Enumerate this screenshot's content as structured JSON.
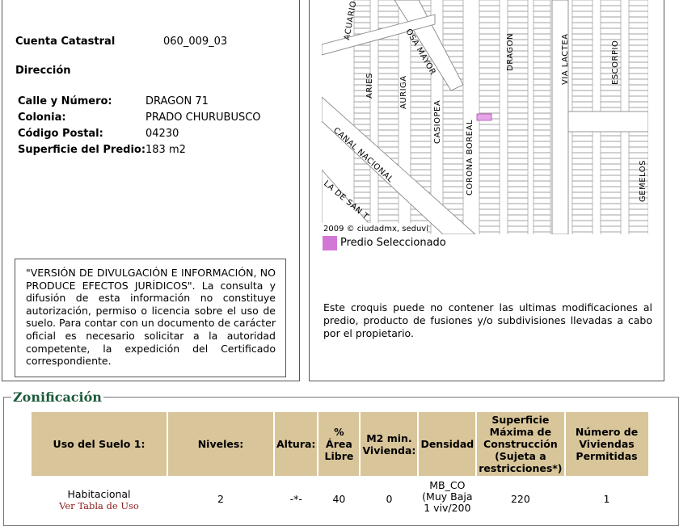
{
  "info": {
    "cuenta_label": "Cuenta Catastral",
    "cuenta_value": "060_009_03",
    "direccion_label": "Dirección",
    "calle_label": "Calle y Número:",
    "calle_value": "DRAGON 71",
    "colonia_label": "Colonia:",
    "colonia_value": "PRADO CHURUBUSCO",
    "cp_label": "Código Postal:",
    "cp_value": "04230",
    "superficie_label": "Superficie del Predio:",
    "superficie_value": "183 m2"
  },
  "disclaimer": "\"VERSIÓN DE DIVULGACIÓN E INFORMACIÓN, NO PRODUCE EFECTOS JURÍDICOS\". La consulta y difusión de esta información no constituye autorización, permiso o licencia sobre el uso de suelo. Para contar con un documento de carácter oficial es necesario solicitar a la autoridad competente, la expedición del Certificado correspondiente.",
  "map": {
    "credit": "2009 © ciudadmx, seduvi",
    "streets": [
      "ACUARIO",
      "OSA MAYOR",
      "ARIES",
      "AURIGA",
      "CASIOPEA",
      "DRAGON",
      "VIA LACTEA",
      "ESCORPIO",
      "CANAL NACIONAL",
      "CORONA BOREAL",
      "GEMELOS",
      "LA DE SAN T"
    ],
    "legend_label": "Predio Seleccionado",
    "highlight_color": "#d277d6",
    "note": "Este croquis puede no contener las ultimas modificaciones al predio, producto de fusiones y/o subdivisiones llevadas a cabo por el propietario."
  },
  "zonificacion": {
    "title": "Zonificación",
    "headers": [
      "Uso del Suelo 1:",
      "Niveles:",
      "Altura:",
      "% Área Libre",
      "M2 min. Vivienda:",
      "Densidad",
      "Superficie Máxima de Construcción (Sujeta a restricciones*)",
      "Número de Viviendas Permitidas"
    ],
    "row": {
      "uso": "Habitacional",
      "uso_link": "Ver Tabla de Uso",
      "niveles": "2",
      "altura": "-*-",
      "area_libre": "40",
      "m2_min": "0",
      "densidad": "MB_CO (Muy Baja 1 viv/200",
      "superficie_max": "220",
      "num_viviendas": "1"
    }
  }
}
